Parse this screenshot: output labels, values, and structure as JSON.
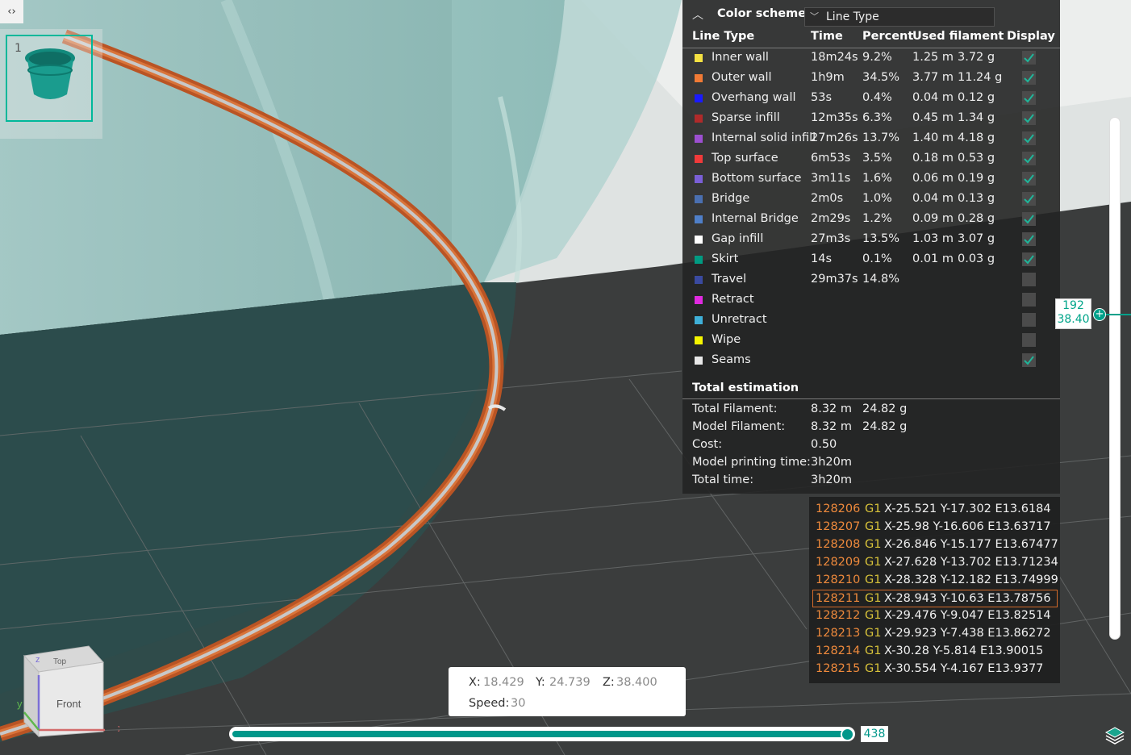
{
  "viewport": {
    "toggle_icon": "‹›",
    "plate_number": "1"
  },
  "legend": {
    "title": "Color scheme",
    "scheme_value": "Line Type",
    "headers": {
      "type": "Line Type",
      "time": "Time",
      "percent": "Percent",
      "used": "Used filament",
      "display": "Display"
    },
    "rows": [
      {
        "name": "Inner wall",
        "color": "#f5e142",
        "time": "18m24s",
        "percent": "9.2%",
        "meters": "1.25 m",
        "grams": "3.72 g",
        "checked": true
      },
      {
        "name": "Outer wall",
        "color": "#f07a35",
        "time": "1h9m",
        "percent": "34.5%",
        "meters": "3.77 m",
        "grams": "11.24 g",
        "checked": true
      },
      {
        "name": "Overhang wall",
        "color": "#1a1aff",
        "time": "53s",
        "percent": "0.4%",
        "meters": "0.04 m",
        "grams": "0.12 g",
        "checked": true
      },
      {
        "name": "Sparse infill",
        "color": "#b02a2a",
        "time": "12m35s",
        "percent": "6.3%",
        "meters": "0.45 m",
        "grams": "1.34 g",
        "checked": true
      },
      {
        "name": "Internal solid infill",
        "color": "#9c4fd0",
        "time": "27m26s",
        "percent": "13.7%",
        "meters": "1.40 m",
        "grams": "4.18 g",
        "checked": true
      },
      {
        "name": "Top surface",
        "color": "#f03a3a",
        "time": "6m53s",
        "percent": "3.5%",
        "meters": "0.18 m",
        "grams": "0.53 g",
        "checked": true
      },
      {
        "name": "Bottom surface",
        "color": "#7a5fd6",
        "time": "3m11s",
        "percent": "1.6%",
        "meters": "0.06 m",
        "grams": "0.19 g",
        "checked": true
      },
      {
        "name": "Bridge",
        "color": "#4a6fb0",
        "time": "2m0s",
        "percent": "1.0%",
        "meters": "0.04 m",
        "grams": "0.13 g",
        "checked": true
      },
      {
        "name": "Internal Bridge",
        "color": "#4f7fc8",
        "time": "2m29s",
        "percent": "1.2%",
        "meters": "0.09 m",
        "grams": "0.28 g",
        "checked": true
      },
      {
        "name": "Gap infill",
        "color": "#ffffff",
        "time": "27m3s",
        "percent": "13.5%",
        "meters": "1.03 m",
        "grams": "3.07 g",
        "checked": true
      },
      {
        "name": "Skirt",
        "color": "#009b82",
        "time": "14s",
        "percent": "0.1%",
        "meters": "0.01 m",
        "grams": "0.03 g",
        "checked": true
      },
      {
        "name": "Travel",
        "color": "#3a4aa0",
        "time": "29m37s",
        "percent": "14.8%",
        "meters": "",
        "grams": "",
        "checked": false
      },
      {
        "name": "Retract",
        "color": "#e02ae0",
        "time": "",
        "percent": "",
        "meters": "",
        "grams": "",
        "checked": false
      },
      {
        "name": "Unretract",
        "color": "#3fb0d8",
        "time": "",
        "percent": "",
        "meters": "",
        "grams": "",
        "checked": false
      },
      {
        "name": "Wipe",
        "color": "#f5f500",
        "time": "",
        "percent": "",
        "meters": "",
        "grams": "",
        "checked": false
      },
      {
        "name": "Seams",
        "color": "#e8e8e8",
        "time": "",
        "percent": "",
        "meters": "",
        "grams": "",
        "checked": true
      }
    ],
    "total_title": "Total estimation",
    "totals": [
      {
        "label": "Total Filament:",
        "value": "8.32 m",
        "extra": "24.82 g"
      },
      {
        "label": "Model Filament:",
        "value": "8.32 m",
        "extra": "24.82 g"
      },
      {
        "label": "Cost:",
        "value": "0.50",
        "extra": ""
      },
      {
        "label": "Model printing time:",
        "value": "3h20m",
        "extra": ""
      },
      {
        "label": "Total time:",
        "value": "3h20m",
        "extra": ""
      }
    ]
  },
  "gcode": {
    "active_index": 5,
    "lines": [
      {
        "num": "128206",
        "cmd": "G1",
        "args": "X-25.521 Y-17.302 E13.6184"
      },
      {
        "num": "128207",
        "cmd": "G1",
        "args": "X-25.98 Y-16.606 E13.63717"
      },
      {
        "num": "128208",
        "cmd": "G1",
        "args": "X-26.846 Y-15.177 E13.67477"
      },
      {
        "num": "128209",
        "cmd": "G1",
        "args": "X-27.628 Y-13.702 E13.71234"
      },
      {
        "num": "128210",
        "cmd": "G1",
        "args": "X-28.328 Y-12.182 E13.74999"
      },
      {
        "num": "128211",
        "cmd": "G1",
        "args": "X-28.943 Y-10.63 E13.78756"
      },
      {
        "num": "128212",
        "cmd": "G1",
        "args": "X-29.476 Y-9.047 E13.82514"
      },
      {
        "num": "128213",
        "cmd": "G1",
        "args": "X-29.923 Y-7.438 E13.86272"
      },
      {
        "num": "128214",
        "cmd": "G1",
        "args": "X-30.28 Y-5.814 E13.90015"
      },
      {
        "num": "128215",
        "cmd": "G1",
        "args": "X-30.554 Y-4.167 E13.9377"
      }
    ]
  },
  "layer_slider": {
    "layer": "192",
    "height": "38.40",
    "fraction": 0.63
  },
  "move_slider": {
    "value": "438",
    "fraction": 0.98
  },
  "coords": {
    "x_label": "X:",
    "x": "18.429",
    "y_label": "Y:",
    "y": "24.739",
    "z_label": "Z:",
    "z": "38.400",
    "speed_label": "Speed:",
    "speed": "30"
  },
  "view_cube": {
    "face_front": "Front",
    "face_top": "Top",
    "axis_x": "x",
    "axis_y": "y",
    "axis_z": "z"
  },
  "colors": {
    "accent": "#00978a",
    "filament": "#c8602a",
    "checkbox_tick": "#1fb69a"
  }
}
